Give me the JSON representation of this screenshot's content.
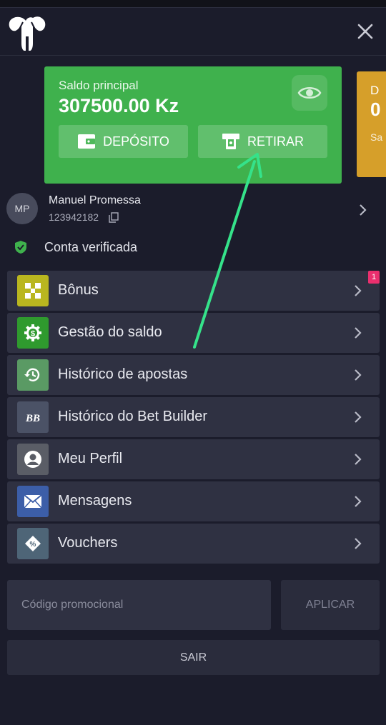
{
  "header": {
    "logo_icon": "elephant-logo",
    "close_icon": "close-icon"
  },
  "balance": {
    "label": "Saldo principal",
    "amount": "307500.00 Kz",
    "deposit_label": "DEPÓSITO",
    "withdraw_label": "RETIRAR",
    "card_color": "#3fb14d",
    "side_card": {
      "line1": "D",
      "line2": "0",
      "line3": "Sa",
      "color": "#d69f2a"
    }
  },
  "user": {
    "initials": "MP",
    "name": "Manuel Promessa",
    "id": "123942182"
  },
  "verification": {
    "text": "Conta verificada"
  },
  "menu": {
    "items": [
      {
        "label": "Bônus",
        "icon": "bonus-icon",
        "badge": "1",
        "color": "#b9b61f"
      },
      {
        "label": "Gestão do saldo",
        "icon": "wallet-settings-icon",
        "color": "#2f9a2e"
      },
      {
        "label": "Histórico de apostas",
        "icon": "history-icon",
        "color": "#5a9a64"
      },
      {
        "label": "Histórico do Bet Builder",
        "icon": "bet-builder-icon",
        "color": "#4b5266"
      },
      {
        "label": "Meu Perfil",
        "icon": "profile-icon",
        "color": "#5a5d66"
      },
      {
        "label": "Mensagens",
        "icon": "mail-icon",
        "color": "#3c5ea8"
      },
      {
        "label": "Vouchers",
        "icon": "voucher-icon",
        "color": "#4e6577"
      }
    ]
  },
  "promo": {
    "placeholder": "Código promocional",
    "apply_label": "APLICAR"
  },
  "logout_label": "SAIR",
  "annotation": {
    "arrow_color": "#35e28a"
  }
}
